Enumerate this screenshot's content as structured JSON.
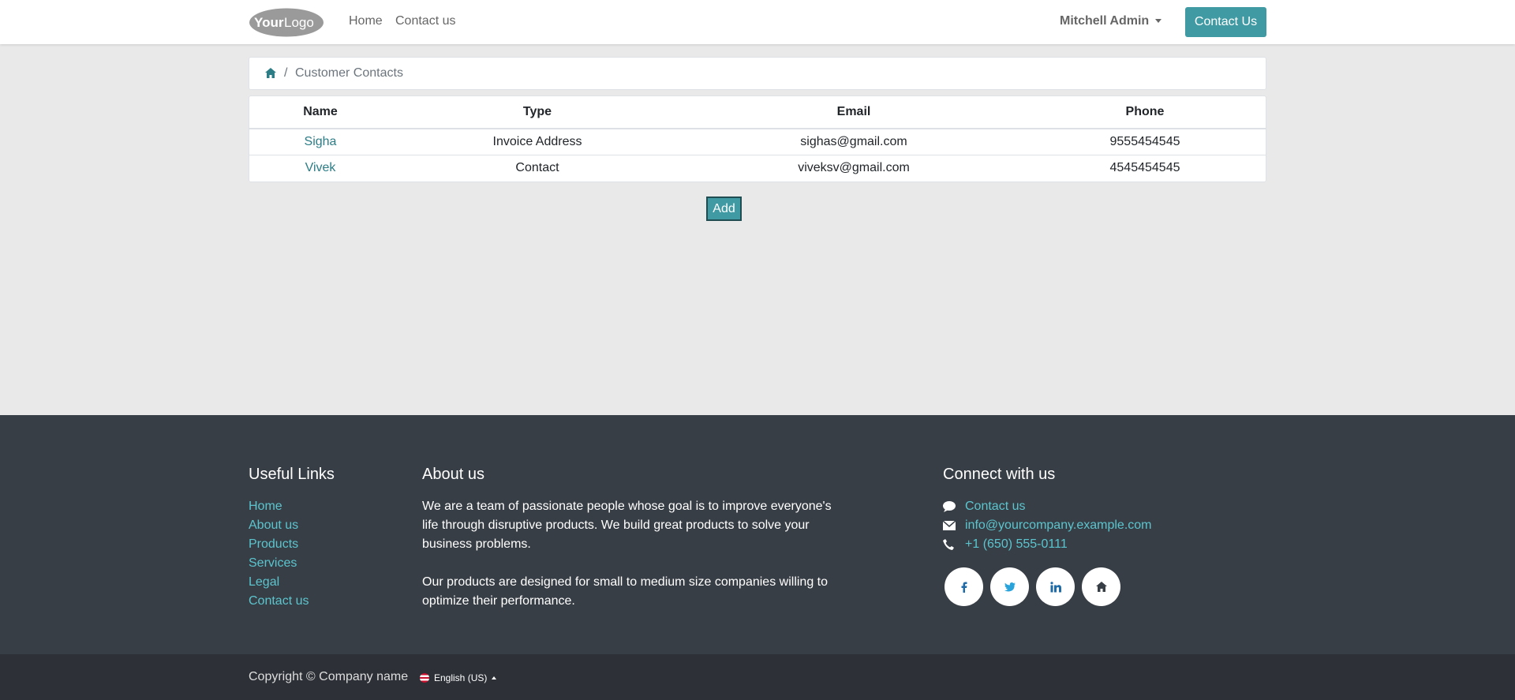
{
  "navbar": {
    "logo_text": "YourLogo",
    "links": [
      {
        "label": "Home"
      },
      {
        "label": "Contact us"
      }
    ],
    "user": "Mitchell Admin",
    "cta": "Contact Us"
  },
  "breadcrumb": {
    "separator": "/",
    "current": "Customer Contacts"
  },
  "table": {
    "headers": [
      "Name",
      "Type",
      "Email",
      "Phone"
    ],
    "rows": [
      {
        "name": "Sigha",
        "type": "Invoice Address",
        "email": "sighas@gmail.com",
        "phone": "9555454545"
      },
      {
        "name": "Vivek",
        "type": "Contact",
        "email": "viveksv@gmail.com",
        "phone": "4545454545"
      }
    ]
  },
  "add_label": "Add",
  "footer": {
    "useful_links_title": "Useful Links",
    "useful_links": [
      "Home",
      "About us",
      "Products",
      "Services",
      "Legal",
      "Contact us"
    ],
    "about_title": "About us",
    "about_p1": "We are a team of passionate people whose goal is to improve everyone's life through disruptive products. We build great products to solve your business problems.",
    "about_p2": "Our products are designed for small to medium size companies willing to optimize their performance.",
    "connect_title": "Connect with us",
    "contact_link": "Contact us",
    "email": "info@yourcompany.example.com",
    "phone": "+1 (650) 555-0111",
    "socials": [
      "facebook-icon",
      "twitter-icon",
      "linkedin-icon",
      "home-icon"
    ]
  },
  "copyright": {
    "text": "Copyright © Company name",
    "language": "English (US)"
  },
  "colors": {
    "accent": "#3f9aa3",
    "link": "#2c7d86",
    "footer_bg": "#383e45",
    "footer_link": "#5bc5cf"
  }
}
